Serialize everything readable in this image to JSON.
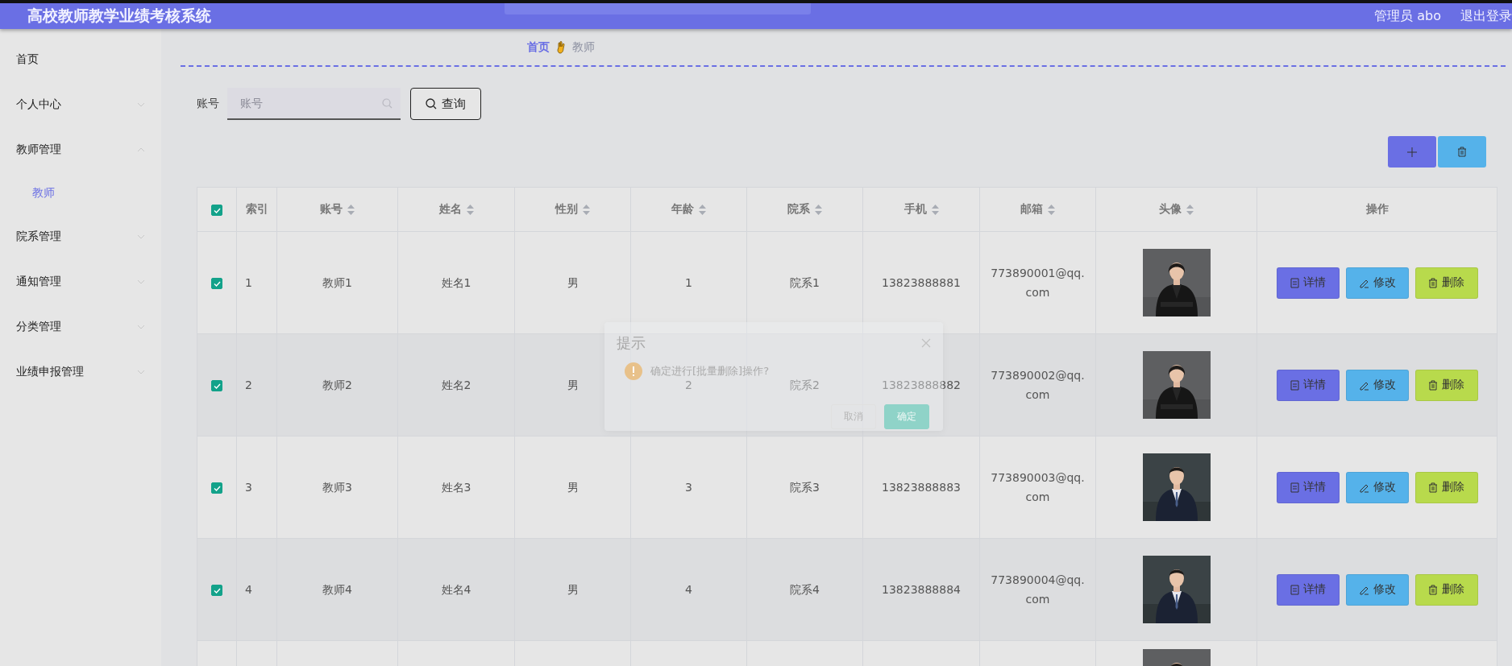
{
  "header": {
    "title": "高校教师教学业绩考核系统",
    "user": "管理员 abo",
    "logout": "退出登录"
  },
  "sidebar": {
    "items": [
      {
        "label": "首页"
      },
      {
        "label": "个人中心",
        "expanded": false
      },
      {
        "label": "教师管理",
        "expanded": true,
        "children": [
          {
            "label": "教师",
            "selected": true
          }
        ]
      },
      {
        "label": "院系管理",
        "expanded": false
      },
      {
        "label": "通知管理",
        "expanded": false
      },
      {
        "label": "分类管理",
        "expanded": false
      },
      {
        "label": "业绩申报管理",
        "expanded": false
      }
    ]
  },
  "breadcrumb": [
    {
      "label": "首页",
      "current": false
    },
    {
      "label": "教师",
      "current": true
    }
  ],
  "search": {
    "label": "账号",
    "placeholder": "账号",
    "button": "查询"
  },
  "table": {
    "select_all_checked": true,
    "columns": [
      {
        "label": "索引",
        "sortable": false
      },
      {
        "label": "账号",
        "sortable": true
      },
      {
        "label": "姓名",
        "sortable": true
      },
      {
        "label": "性别",
        "sortable": true
      },
      {
        "label": "年龄",
        "sortable": true
      },
      {
        "label": "院系",
        "sortable": true
      },
      {
        "label": "手机",
        "sortable": true
      },
      {
        "label": "邮箱",
        "sortable": true
      },
      {
        "label": "头像",
        "sortable": true
      },
      {
        "label": "操作",
        "sortable": false
      }
    ],
    "rows": [
      {
        "checked": true,
        "cells": [
          "1",
          "教师1",
          "姓名1",
          "男",
          "1",
          "院系1",
          "13823888881",
          "773890001@qq.com"
        ],
        "avatar": {
          "kind": "picture"
        },
        "actions": [
          "详情",
          "修改",
          "删除"
        ]
      },
      {
        "checked": true,
        "cells": [
          "2",
          "教师2",
          "姓名2",
          "男",
          "2",
          "院系2",
          "13823888882",
          "773890002@qq.com"
        ],
        "avatar": {
          "kind": "picture"
        },
        "actions": [
          "详情",
          "修改",
          "删除"
        ]
      },
      {
        "checked": true,
        "cells": [
          "3",
          "教师3",
          "姓名3",
          "男",
          "3",
          "院系3",
          "13823888883",
          "773890003@qq.com"
        ],
        "avatar": {
          "kind": "picture"
        },
        "actions": [
          "详情",
          "修改",
          "删除"
        ]
      },
      {
        "checked": true,
        "cells": [
          "4",
          "教师4",
          "姓名4",
          "男",
          "4",
          "院系4",
          "13823888884",
          "773890004@qq.com"
        ],
        "avatar": {
          "kind": "picture"
        },
        "actions": [
          "详情",
          "修改",
          "删除"
        ]
      },
      {
        "avatar": {
          "kind": "picture"
        }
      }
    ]
  },
  "dialog": {
    "title": "提示",
    "message": "确定进行[批量删除]操作?",
    "cancel": "取消",
    "confirm": "确定"
  }
}
